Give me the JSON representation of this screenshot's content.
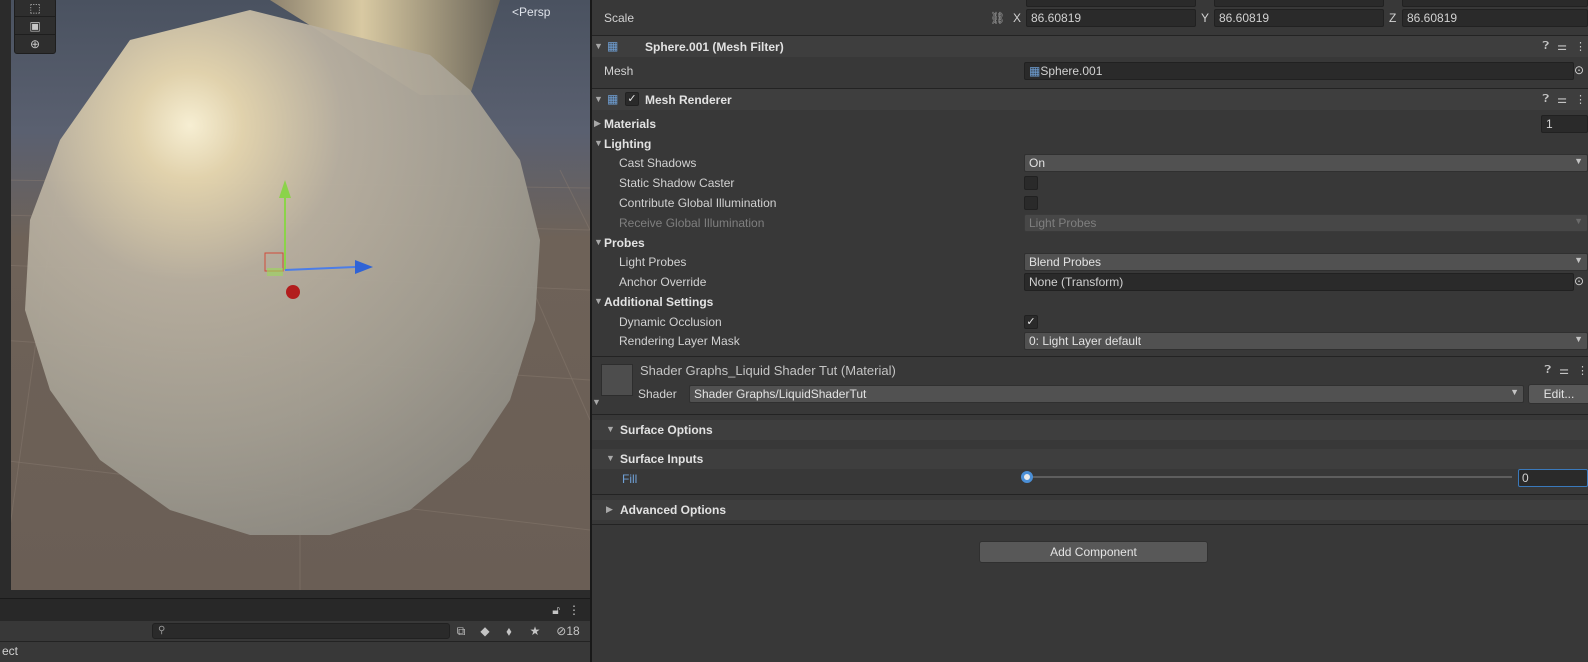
{
  "scene": {
    "persp_label": "Persp",
    "tools": [
      "scale-tool",
      "rect-tool",
      "transform-tool"
    ]
  },
  "project": {
    "footer_text": "ect",
    "hidden_count": "18"
  },
  "inspector": {
    "transform": {
      "scale_label": "Scale",
      "scale_x": "86.60819",
      "scale_y": "86.60819",
      "scale_z": "86.60819",
      "axis_x": "X",
      "axis_y": "Y",
      "axis_z": "Z"
    },
    "mesh_filter": {
      "title": "Sphere.001 (Mesh Filter)",
      "mesh_label": "Mesh",
      "mesh_value": "Sphere.001"
    },
    "mesh_renderer": {
      "title": "Mesh Renderer",
      "enabled": true,
      "materials_label": "Materials",
      "materials_count": "1",
      "lighting_label": "Lighting",
      "cast_shadows_label": "Cast Shadows",
      "cast_shadows_value": "On",
      "static_shadow_label": "Static Shadow Caster",
      "static_shadow_checked": false,
      "contribute_gi_label": "Contribute Global Illumination",
      "contribute_gi_checked": false,
      "receive_gi_label": "Receive Global Illumination",
      "receive_gi_value": "Light Probes",
      "probes_label": "Probes",
      "light_probes_label": "Light Probes",
      "light_probes_value": "Blend Probes",
      "anchor_override_label": "Anchor Override",
      "anchor_override_value": "None (Transform)",
      "additional_label": "Additional Settings",
      "dynamic_occlusion_label": "Dynamic Occlusion",
      "dynamic_occlusion_checked": true,
      "rendering_layer_label": "Rendering Layer Mask",
      "rendering_layer_value": "0: Light Layer default"
    },
    "material": {
      "title": "Shader Graphs_Liquid Shader Tut (Material)",
      "shader_label": "Shader",
      "shader_value": "Shader Graphs/LiquidShaderTut",
      "edit_label": "Edit...",
      "surface_options_label": "Surface Options",
      "surface_inputs_label": "Surface Inputs",
      "fill_label": "Fill",
      "fill_value": "0",
      "fill_fraction": 0,
      "advanced_options_label": "Advanced Options"
    },
    "add_component_label": "Add Component"
  },
  "colors": {
    "accent_blue": "#4b8fd6",
    "panel_bg": "#383838",
    "header_bg": "#3e3e3e"
  }
}
